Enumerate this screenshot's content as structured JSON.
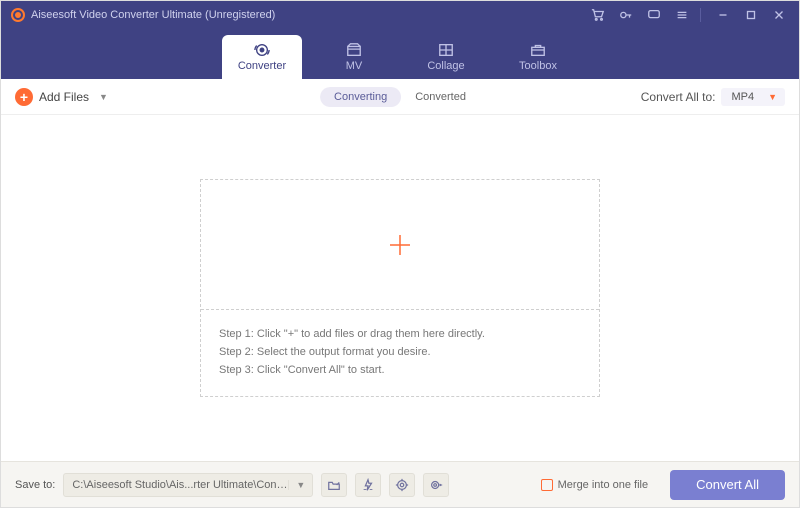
{
  "title": "Aiseesoft Video Converter Ultimate (Unregistered)",
  "tabs": {
    "converter": "Converter",
    "mv": "MV",
    "collage": "Collage",
    "toolbox": "Toolbox"
  },
  "toolbar": {
    "add_files": "Add Files",
    "converting": "Converting",
    "converted": "Converted",
    "convert_all_to": "Convert All to:",
    "format": "MP4"
  },
  "dropzone": {
    "step1": "Step 1: Click \"+\" to add files or drag them here directly.",
    "step2": "Step 2: Select the output format you desire.",
    "step3": "Step 3: Click \"Convert All\" to start."
  },
  "bottom": {
    "save_to": "Save to:",
    "path": "C:\\Aiseesoft Studio\\Ais...rter Ultimate\\Converted",
    "merge": "Merge into one file",
    "convert_all": "Convert All"
  }
}
